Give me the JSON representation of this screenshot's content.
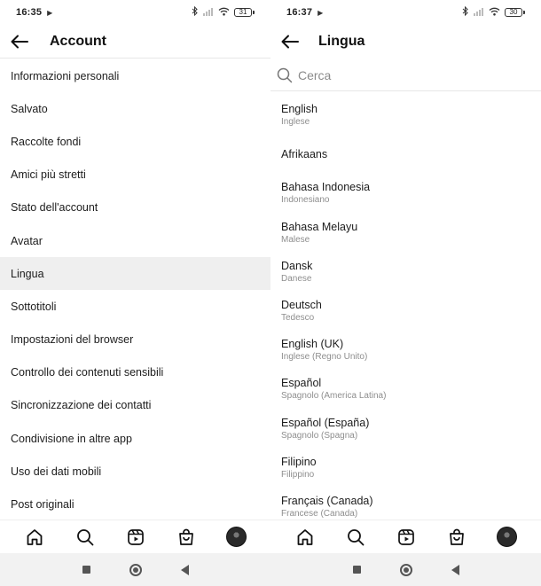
{
  "left": {
    "status": {
      "time": "16:35",
      "battery": "31"
    },
    "title": "Account",
    "items": [
      "Informazioni personali",
      "Salvato",
      "Raccolte fondi",
      "Amici più stretti",
      "Stato dell'account",
      "Avatar",
      "Lingua",
      "Sottotitoli",
      "Impostazioni del browser",
      "Controllo dei contenuti sensibili",
      "Sincronizzazione dei contatti",
      "Condivisione in altre app",
      "Uso dei dati mobili",
      "Post originali"
    ],
    "active_item": "Lingua"
  },
  "right": {
    "status": {
      "time": "16:37",
      "battery": "30"
    },
    "title": "Lingua",
    "search_placeholder": "Cerca",
    "languages": [
      {
        "name": "English",
        "sub": "Inglese"
      },
      {
        "name": "Afrikaans",
        "sub": ""
      },
      {
        "name": "Bahasa Indonesia",
        "sub": "Indonesiano"
      },
      {
        "name": "Bahasa Melayu",
        "sub": "Malese"
      },
      {
        "name": "Dansk",
        "sub": "Danese"
      },
      {
        "name": "Deutsch",
        "sub": "Tedesco"
      },
      {
        "name": "English (UK)",
        "sub": "Inglese (Regno Unito)"
      },
      {
        "name": "Español",
        "sub": "Spagnolo (America Latina)"
      },
      {
        "name": "Español (España)",
        "sub": "Spagnolo (Spagna)"
      },
      {
        "name": "Filipino",
        "sub": "Filippino"
      },
      {
        "name": "Français (Canada)",
        "sub": "Francese (Canada)"
      }
    ]
  },
  "nav_icons": [
    "home-icon",
    "search-icon",
    "reels-icon",
    "shop-icon",
    "profile-avatar"
  ],
  "colors": {
    "active_row": "#efefef",
    "secondary_text": "#8e8e8e",
    "divider": "#e7e7e7"
  }
}
